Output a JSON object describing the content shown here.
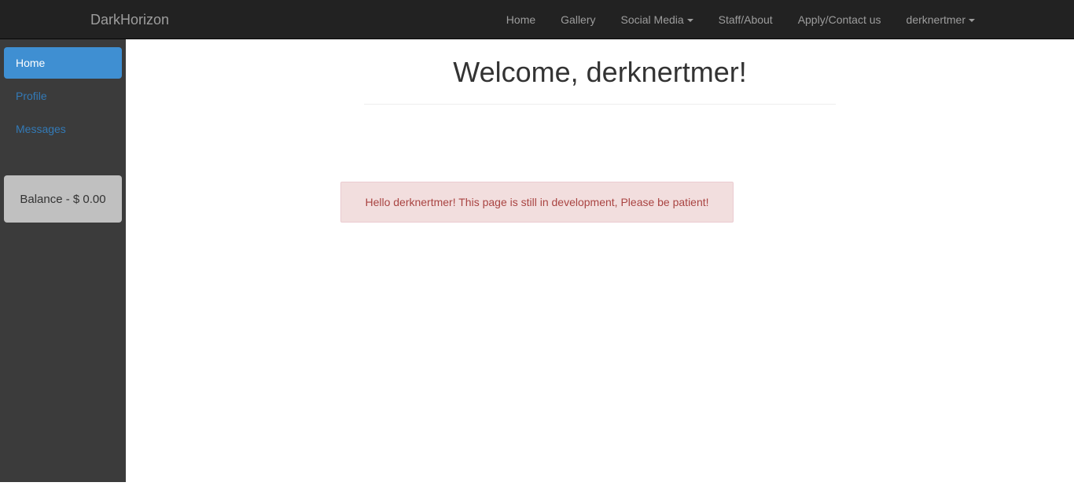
{
  "navbar": {
    "brand": "DarkHorizon",
    "links": [
      {
        "label": "Home",
        "caret": false
      },
      {
        "label": "Gallery",
        "caret": false
      },
      {
        "label": "Social Media",
        "caret": true
      },
      {
        "label": "Staff/About",
        "caret": false
      },
      {
        "label": "Apply/Contact us",
        "caret": false
      },
      {
        "label": "derknertmer",
        "caret": true
      }
    ]
  },
  "sidebar": {
    "items": [
      {
        "label": "Home",
        "active": true
      },
      {
        "label": "Profile",
        "active": false
      },
      {
        "label": "Messages",
        "active": false
      }
    ],
    "balance": "Balance - $ 0.00"
  },
  "main": {
    "title": "Welcome, derknertmer!",
    "alert": "Hello derknertmer! This page is still in development, Please be patient!"
  },
  "colors": {
    "navbar_bg": "#222222",
    "navbar_text": "#9d9d9d",
    "sidebar_bg": "#3b3b3b",
    "sidebar_link": "#337ab7",
    "sidebar_active_bg": "#3f8fd2",
    "balance_bg": "#c0c0c0",
    "alert_bg": "#f2dede",
    "alert_border": "#ebccd1",
    "alert_text": "#a94442",
    "content_bg": "#ffffff"
  }
}
